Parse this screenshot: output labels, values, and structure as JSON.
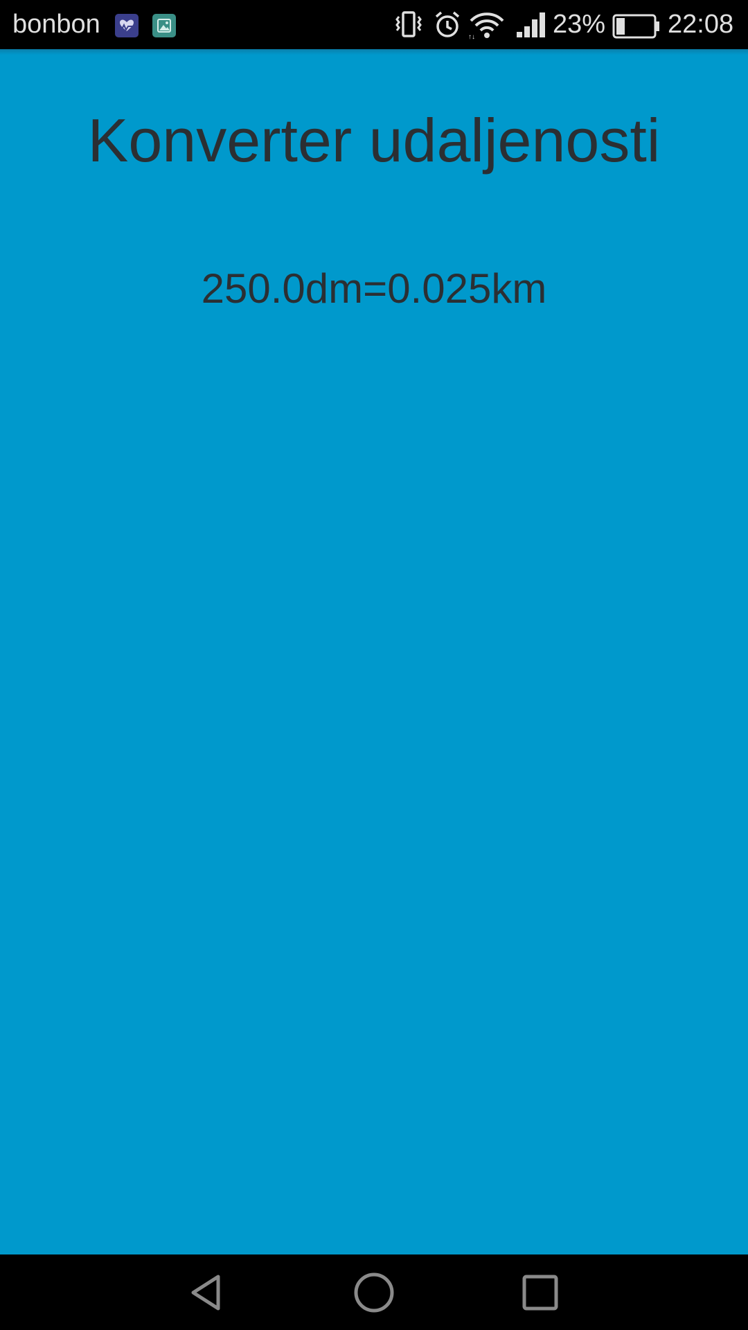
{
  "status_bar": {
    "carrier": "bonbon",
    "notification_icons": [
      "health-app-icon",
      "gallery-app-icon"
    ],
    "system_icons": [
      "vibrate-icon",
      "alarm-icon",
      "wifi-icon",
      "signal-icon",
      "battery-icon"
    ],
    "battery_percent": "23%",
    "battery_level": 0.23,
    "time": "22:08"
  },
  "app": {
    "title": "Konverter udaljenosti",
    "result": "250.0dm=0.025km",
    "background_color": "#0099cc",
    "text_color": "#2b2f33"
  },
  "nav_bar": {
    "buttons": [
      "back-icon",
      "home-icon",
      "recents-icon"
    ]
  }
}
